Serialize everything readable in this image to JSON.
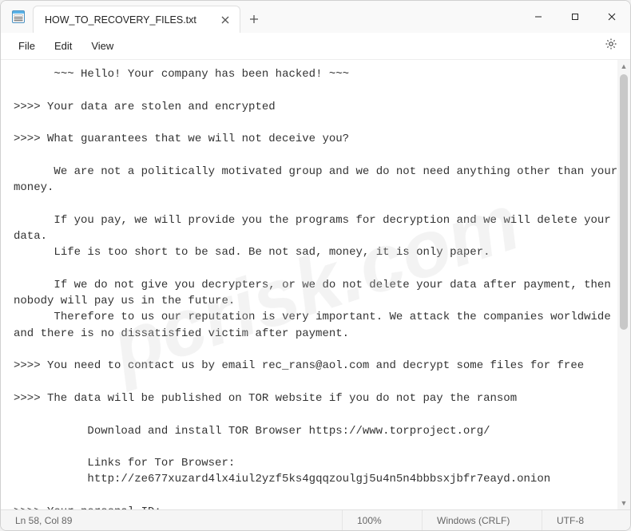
{
  "tab": {
    "title": "HOW_TO_RECOVERY_FILES.txt"
  },
  "menu": {
    "file": "File",
    "edit": "Edit",
    "view": "View"
  },
  "document": {
    "text": "      ~~~ Hello! Your company has been hacked! ~~~\n\n>>>> Your data are stolen and encrypted\n\n>>>> What guarantees that we will not deceive you?\n\n      We are not a politically motivated group and we do not need anything other than your money.\n\n      If you pay, we will provide you the programs for decryption and we will delete your data.\n      Life is too short to be sad. Be not sad, money, it is only paper.\n\n      If we do not give you decrypters, or we do not delete your data after payment, then nobody will pay us in the future.\n      Therefore to us our reputation is very important. We attack the companies worldwide and there is no dissatisfied victim after payment.\n\n>>>> You need to contact us by email rec_rans@aol.com and decrypt some files for free\n\n>>>> The data will be published on TOR website if you do not pay the ransom\n\n           Download and install TOR Browser https://www.torproject.org/\n\n           Links for Tor Browser:\n           http://ze677xuzard4lx4iul2yzf5ks4gqqzoulgj5u4n5n4bbbsxjbfr7eayd.onion\n\n>>>> Your personal ID:"
  },
  "status": {
    "cursor": "Ln 58, Col 89",
    "zoom": "100%",
    "line_ending": "Windows (CRLF)",
    "encoding": "UTF-8"
  },
  "watermark": "pcrisk.com"
}
